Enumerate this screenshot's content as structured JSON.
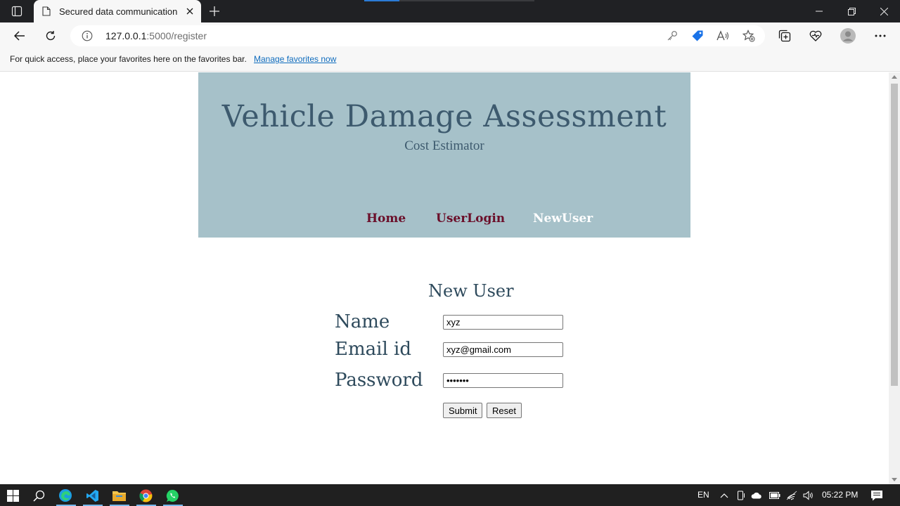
{
  "browser": {
    "tab_title": "Secured data communication",
    "url_host": "127.0.0.1",
    "url_path": ":5000/register",
    "favorites_text": "For quick access, place your favorites here on the favorites bar.",
    "favorites_link": "Manage favorites now"
  },
  "site": {
    "title": "Vehicle Damage Assessment",
    "subtitle": "Cost Estimator",
    "nav": [
      {
        "label": "Home",
        "active": false
      },
      {
        "label": "UserLogin",
        "active": false
      },
      {
        "label": "NewUser",
        "active": true
      }
    ]
  },
  "form": {
    "heading": "New User",
    "fields": [
      {
        "label": "Name",
        "value": "xyz",
        "type": "text"
      },
      {
        "label": "Email id",
        "value": "xyz@gmail.com",
        "type": "text"
      },
      {
        "label": "Password",
        "value": "1234567",
        "type": "password"
      }
    ],
    "submit_label": "Submit",
    "reset_label": "Reset"
  },
  "taskbar": {
    "language": "EN",
    "time": "05:22 PM"
  },
  "colors": {
    "banner": "#a6c1c9",
    "title_text": "#3d5a6e",
    "nav_text": "#6b0f2a",
    "nav_active": "#ffffff",
    "link": "#0f6cbd"
  }
}
